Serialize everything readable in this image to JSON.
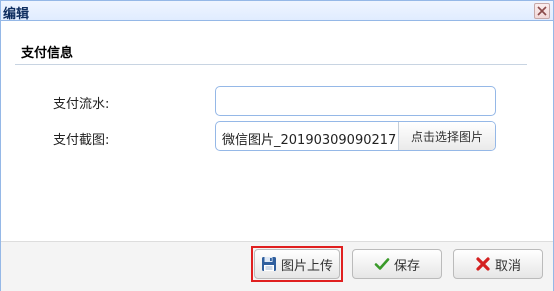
{
  "window": {
    "title": "编辑",
    "close_icon": "close-icon"
  },
  "section": {
    "title": "支付信息"
  },
  "form": {
    "serial_label": "支付流水:",
    "serial_value": "",
    "screenshot_label": "支付截图:",
    "screenshot_filename": "微信图片_20190309090217",
    "choose_image_label": "点击选择图片"
  },
  "footer": {
    "upload_label": "图片上传",
    "upload_icon": "floppy-disk-icon",
    "save_label": "保存",
    "save_icon": "checkmark-icon",
    "cancel_label": "取消",
    "cancel_icon": "red-x-icon",
    "highlight_color": "#e02020"
  }
}
